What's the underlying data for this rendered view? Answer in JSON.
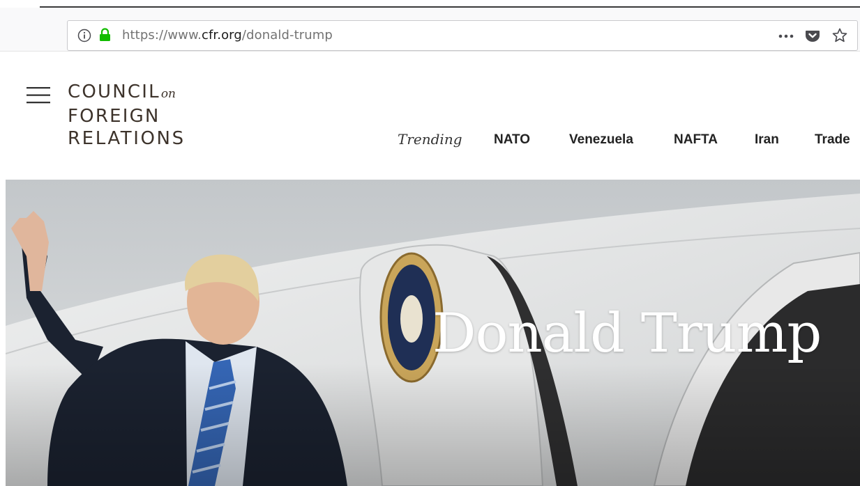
{
  "browser": {
    "url_prefix": "https://www.",
    "url_domain": "cfr.org",
    "url_path": "/donald-trump",
    "icons": [
      "info-icon",
      "lock-icon",
      "more-icon",
      "pocket-icon",
      "star-icon"
    ],
    "lock_color": "#12bc00"
  },
  "header": {
    "logo": {
      "line1": "COUNCIL",
      "line1_suffix": "on",
      "line2": "FOREIGN",
      "line3": "RELATIONS"
    },
    "trending_label": "Trending",
    "nav": [
      {
        "label": "NATO"
      },
      {
        "label": "Venezuela"
      },
      {
        "label": "NAFTA"
      },
      {
        "label": "Iran"
      },
      {
        "label": "Trade"
      }
    ]
  },
  "hero": {
    "title": "Donald Trump",
    "image": "photo of Donald Trump waving beside aircraft door with presidential seal"
  },
  "colors": {
    "logo": "#3d332b",
    "nav_text": "#222222",
    "hero_title": "#ffffff"
  }
}
